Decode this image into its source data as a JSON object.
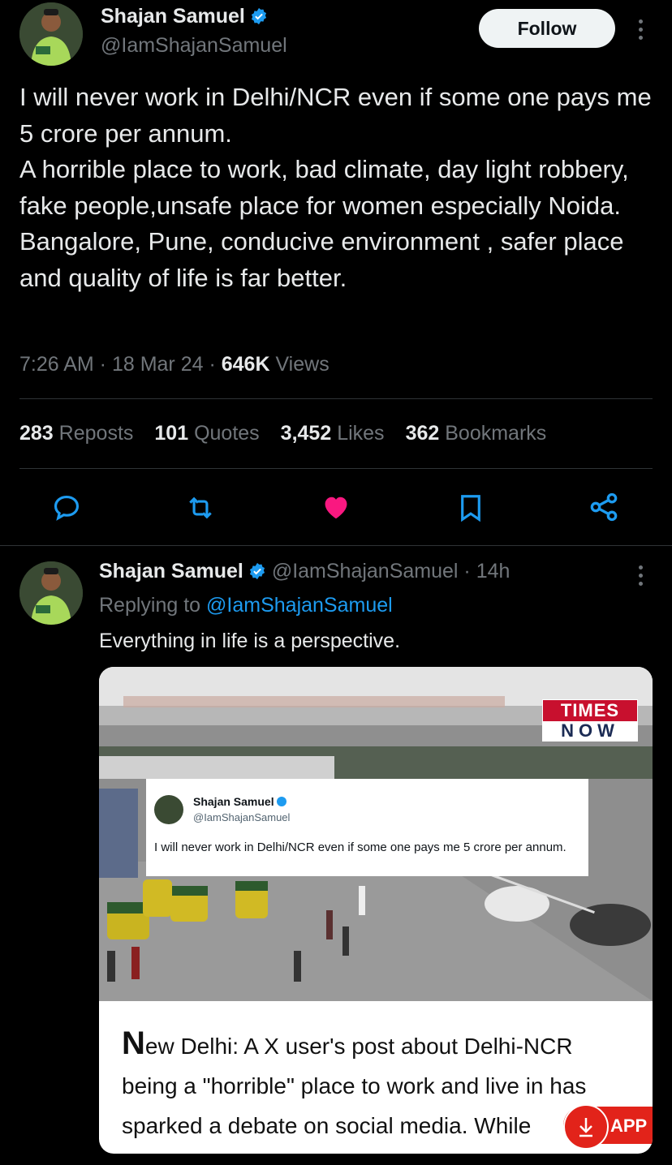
{
  "main_tweet": {
    "author_name": "Shajan Samuel",
    "author_handle": "@IamShajanSamuel",
    "follow_label": "Follow",
    "text": "I will never work in Delhi/NCR  even if some one pays me 5 crore per annum.\nA horrible place to work, bad climate, day light robbery, fake people,unsafe place for women especially Noida.\nBangalore, Pune, conducive environment , safer place and quality of life is far better.",
    "time": "7:26 AM",
    "date": "18 Mar 24",
    "views_count": "646K",
    "views_label": "Views",
    "stats": {
      "reposts_count": "283",
      "reposts_label": "Reposts",
      "quotes_count": "101",
      "quotes_label": "Quotes",
      "likes_count": "3,452",
      "likes_label": "Likes",
      "bookmarks_count": "362",
      "bookmarks_label": "Bookmarks"
    },
    "actions": [
      "reply-icon",
      "repost-icon",
      "like-icon",
      "bookmark-icon",
      "share-icon"
    ]
  },
  "reply_tweet": {
    "author_name": "Shajan Samuel",
    "author_handle": "@IamShajanSamuel",
    "age": "14h",
    "replying_prefix": "Replying to",
    "replying_handle": "@IamShajanSamuel",
    "text": "Everything in life is a perspective.",
    "card": {
      "logo_line1": "TIMES",
      "logo_line2": "NOW",
      "embedded_name": "Shajan Samuel",
      "embedded_handle": "@IamShajanSamuel",
      "embedded_text": "I will never work in Delhi/NCR  even if some one pays me 5 crore per annum.",
      "article_first_letter": "N",
      "article_text_rest": "ew Delhi: A X user's post about Delhi-NCR being a \"horrible\" place to work and live in has sparked a debate on social media. While",
      "app_label": "APP"
    }
  },
  "colors": {
    "background": "#000000",
    "text": "#e7e9ea",
    "muted": "#71767b",
    "accent": "#1d9bf0",
    "like": "#f91880",
    "app_red": "#e2231a"
  }
}
